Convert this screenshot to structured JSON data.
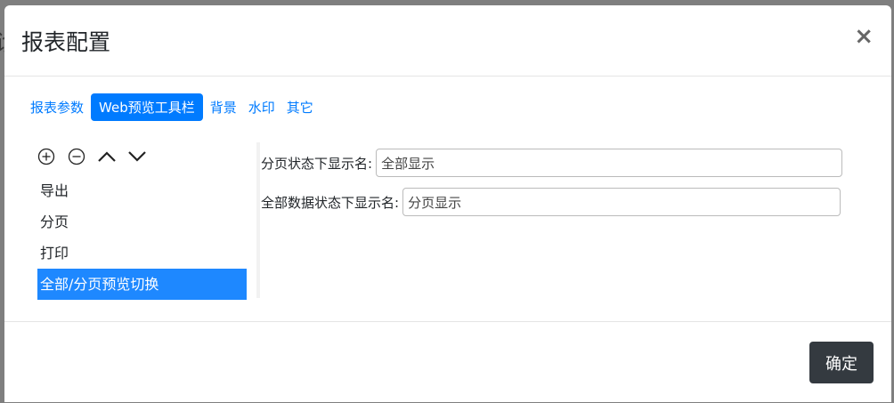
{
  "dialog": {
    "title": "报表配置",
    "close_label": "×"
  },
  "tabs": [
    {
      "label": "报表参数",
      "active": false
    },
    {
      "label": "Web预览工具栏",
      "active": true
    },
    {
      "label": "背景",
      "active": false
    },
    {
      "label": "水印",
      "active": false
    },
    {
      "label": "其它",
      "active": false
    }
  ],
  "toolbar": {
    "icons": [
      "add-circle-icon",
      "remove-circle-icon",
      "chevron-up-icon",
      "chevron-down-icon"
    ]
  },
  "list": {
    "items": [
      "导出",
      "分页",
      "打印",
      "全部/分页预览切换"
    ],
    "selected_index": 3
  },
  "form": {
    "paged_label": "分页状态下显示名:",
    "paged_value": "全部显示",
    "all_label": "全部数据状态下显示名:",
    "all_value": "分页显示"
  },
  "footer": {
    "ok_label": "确定"
  },
  "colors": {
    "accent": "#007bff",
    "selected": "#1e88ff",
    "dark_button": "#343a40"
  }
}
